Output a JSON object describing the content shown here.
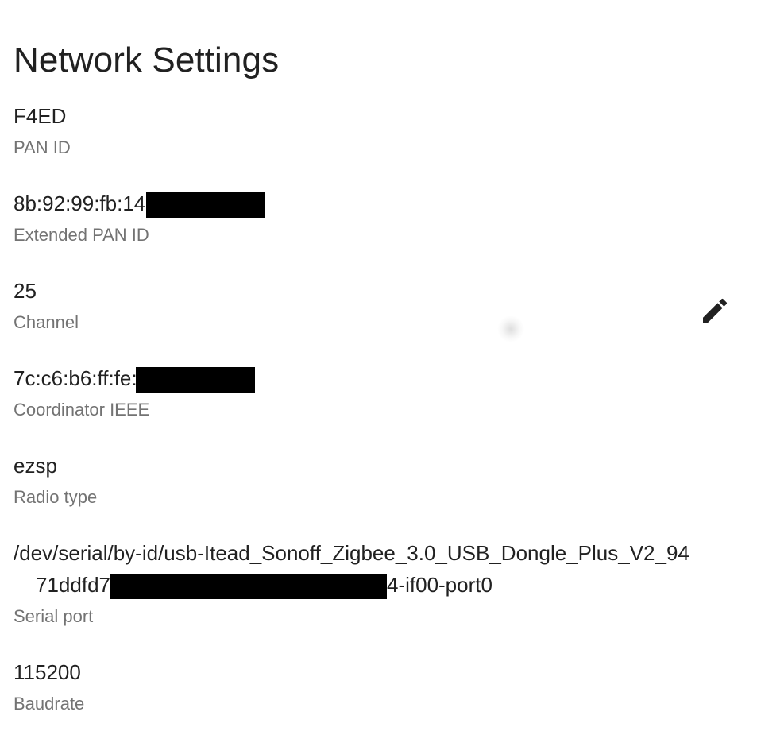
{
  "page": {
    "title": "Network Settings"
  },
  "settings": {
    "pan_id": {
      "value": "F4ED",
      "label": "PAN ID"
    },
    "extended_pan_id": {
      "value_visible": "8b:92:99:fb:14:",
      "label": "Extended PAN ID"
    },
    "channel": {
      "value": "25",
      "label": "Channel"
    },
    "coordinator_ieee": {
      "value_visible": "7c:c6:b6:ff:fe:",
      "label": "Coordinator IEEE"
    },
    "radio_type": {
      "value": "ezsp",
      "label": "Radio type"
    },
    "serial_port": {
      "value_line1": "/dev/serial/by-id/usb-Itead_Sonoff_Zigbee_3.0_USB_Dongle_Plus_V2_94",
      "value_line2_prefix": "71ddfd7",
      "value_line2_suffix": "4-if00-port0",
      "label": "Serial port"
    },
    "baudrate": {
      "value": "115200",
      "label": "Baudrate"
    }
  },
  "icons": {
    "edit": "edit-icon"
  },
  "colors": {
    "primary_text": "#212121",
    "secondary_text": "#737373",
    "redaction": "#000000",
    "background": "#ffffff"
  }
}
